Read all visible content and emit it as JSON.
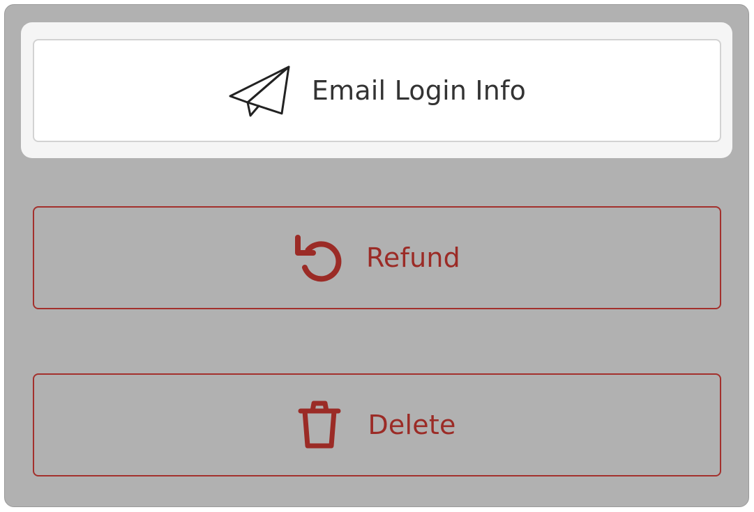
{
  "actions": {
    "email_login_info": {
      "label": "Email Login Info",
      "icon": "paper-plane-icon"
    },
    "refund": {
      "label": "Refund",
      "icon": "refund-undo-icon"
    },
    "delete": {
      "label": "Delete",
      "icon": "trash-icon"
    }
  },
  "colors": {
    "panel_background": "#b1b1b1",
    "highlight_background": "#f5f5f5",
    "destructive": "#9b2b26",
    "primary_text": "#333333"
  }
}
